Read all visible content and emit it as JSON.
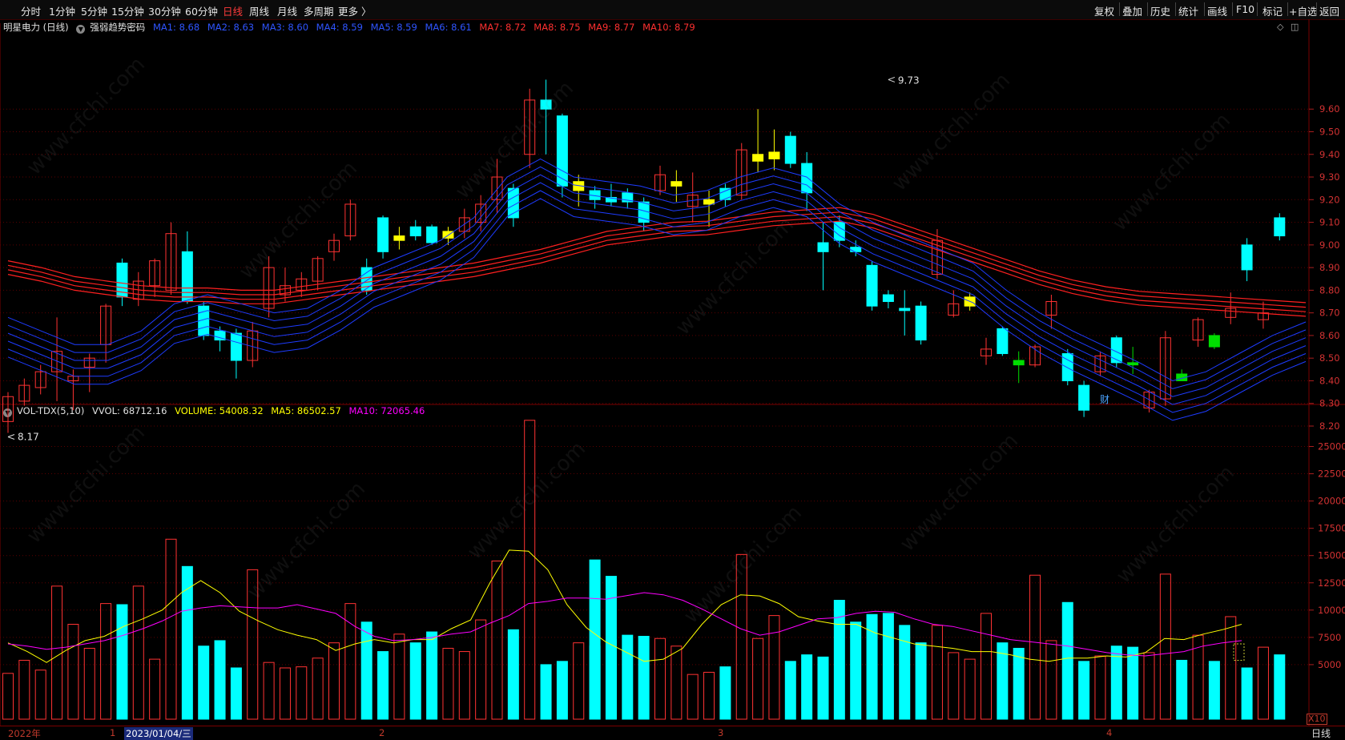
{
  "toolbar": {
    "left_tabs": [
      "分时",
      "1分钟",
      "5分钟",
      "15分钟",
      "30分钟",
      "60分钟",
      "日线",
      "周线",
      "月线",
      "多周期",
      "更多 〉"
    ],
    "active_tab": "日线",
    "right_tabs": [
      "复权",
      "叠加",
      "历史",
      "统计",
      "画线",
      "F10",
      "标记",
      "+自选",
      "返回"
    ]
  },
  "main_legend": {
    "stock": "明星电力 (日线)",
    "indicator": "强弱趋势密码",
    "ma_blue": [
      "MA1: 8.68",
      "MA2: 8.63",
      "MA3: 8.60",
      "MA4: 8.59",
      "MA5: 8.59",
      "MA6: 8.61"
    ],
    "ma_red": [
      "MA7: 8.72",
      "MA8: 8.75",
      "MA9: 8.77",
      "MA10: 8.79"
    ]
  },
  "vol_legend": {
    "name": "VOL-TDX(5,10)",
    "vvol": "VVOL: 68712.16",
    "volume": "VOLUME: 54008.32",
    "ma5": "MA5: 86502.57",
    "ma10": "MA10: 72065.46"
  },
  "annotations": {
    "high": "9.73",
    "low": "8.17",
    "cai": "财",
    "x10": "X10",
    "period": "日线"
  },
  "x_axis_labels": [
    "2022年",
    "1",
    "2023/01/04/三",
    "2",
    "3",
    "4"
  ],
  "watermark": "www.cfchi.com",
  "colors": {
    "up": "#ff3232",
    "down_big": "#00ffff",
    "yellow": "#ffff00",
    "green": "#00dd00",
    "ma_blue": "#1e3cff",
    "ma_red": "#ff2020",
    "vol_ma5": "#ffff00",
    "vol_ma10": "#ff00ff"
  },
  "chart_data": [
    {
      "type": "candlestick",
      "title": "明星电力 (日线)",
      "y_ticks": [
        9.6,
        9.5,
        9.4,
        9.3,
        9.2,
        9.1,
        9.0,
        8.9,
        8.8,
        8.7,
        8.6,
        8.5,
        8.4,
        8.3,
        8.2
      ],
      "ylim": [
        8.16,
        9.75
      ],
      "candles": [
        {
          "o": 8.22,
          "c": 8.33,
          "h": 8.35,
          "l": 8.17,
          "k": "up"
        },
        {
          "o": 8.31,
          "c": 8.38,
          "h": 8.41,
          "l": 8.29,
          "k": "up"
        },
        {
          "o": 8.37,
          "c": 8.44,
          "h": 8.47,
          "l": 8.34,
          "k": "up"
        },
        {
          "o": 8.44,
          "c": 8.53,
          "h": 8.68,
          "l": 8.31,
          "k": "up"
        },
        {
          "o": 8.4,
          "c": 8.42,
          "h": 8.45,
          "l": 8.27,
          "k": "up"
        },
        {
          "o": 8.46,
          "c": 8.5,
          "h": 8.52,
          "l": 8.35,
          "k": "up"
        },
        {
          "o": 8.56,
          "c": 8.73,
          "h": 8.74,
          "l": 8.48,
          "k": "up"
        },
        {
          "o": 8.76,
          "c": 8.84,
          "h": 8.88,
          "l": 8.73,
          "k": "up"
        },
        {
          "o": 8.82,
          "c": 8.93,
          "h": 8.94,
          "l": 8.77,
          "k": "up"
        },
        {
          "o": 8.8,
          "c": 9.05,
          "h": 9.1,
          "l": 8.78,
          "k": "up"
        },
        {
          "o": 8.62,
          "c": 8.49,
          "h": 8.66,
          "l": 8.46,
          "k": "up"
        },
        {
          "o": 8.72,
          "c": 8.9,
          "h": 8.95,
          "l": 8.68,
          "k": "up"
        },
        {
          "o": 8.78,
          "c": 8.82,
          "h": 8.9,
          "l": 8.75,
          "k": "up"
        },
        {
          "o": 8.8,
          "c": 8.85,
          "h": 8.88,
          "l": 8.77,
          "k": "up"
        },
        {
          "o": 8.84,
          "c": 8.94,
          "h": 8.95,
          "l": 8.8,
          "k": "up"
        },
        {
          "o": 8.97,
          "c": 9.02,
          "h": 9.05,
          "l": 8.93,
          "k": "up"
        },
        {
          "o": 9.04,
          "c": 9.18,
          "h": 9.2,
          "l": 9.02,
          "k": "up"
        },
        {
          "o": 9.02,
          "c": 9.04,
          "h": 9.08,
          "l": 8.98,
          "k": "up"
        },
        {
          "o": 9.03,
          "c": 9.06,
          "h": 9.08,
          "l": 9.0,
          "k": "up"
        },
        {
          "o": 9.06,
          "c": 9.12,
          "h": 9.16,
          "l": 9.03,
          "k": "up"
        },
        {
          "o": 9.1,
          "c": 9.18,
          "h": 9.22,
          "l": 9.06,
          "k": "up"
        },
        {
          "o": 9.2,
          "c": 9.3,
          "h": 9.38,
          "l": 9.14,
          "k": "up"
        },
        {
          "o": 9.4,
          "c": 9.64,
          "h": 9.69,
          "l": 9.34,
          "k": "up"
        },
        {
          "o": 9.24,
          "c": 9.28,
          "h": 9.31,
          "l": 9.17,
          "k": "up"
        },
        {
          "o": 9.24,
          "c": 9.31,
          "h": 9.35,
          "l": 9.22,
          "k": "up"
        },
        {
          "o": 9.26,
          "c": 9.28,
          "h": 9.33,
          "l": 9.19,
          "k": "up"
        },
        {
          "o": 9.17,
          "c": 9.22,
          "h": 9.32,
          "l": 9.1,
          "k": "up"
        },
        {
          "o": 9.18,
          "c": 9.2,
          "h": 9.24,
          "l": 9.08,
          "k": "up"
        },
        {
          "o": 9.22,
          "c": 9.42,
          "h": 9.45,
          "l": 9.2,
          "k": "up"
        },
        {
          "o": 9.37,
          "c": 9.4,
          "h": 9.6,
          "l": 9.32,
          "k": "up"
        },
        {
          "o": 9.38,
          "c": 9.41,
          "h": 9.51,
          "l": 9.33,
          "k": "up"
        },
        {
          "o": 9.02,
          "c": 8.87,
          "h": 9.07,
          "l": 8.85,
          "k": "up"
        },
        {
          "o": 8.74,
          "c": 8.69,
          "h": 8.8,
          "l": 8.68,
          "k": "up"
        },
        {
          "o": 8.73,
          "c": 8.77,
          "h": 8.79,
          "l": 8.71,
          "k": "up"
        },
        {
          "o": 8.51,
          "c": 8.54,
          "h": 8.59,
          "l": 8.47,
          "k": "up"
        },
        {
          "o": 8.47,
          "c": 8.55,
          "h": 8.56,
          "l": 8.46,
          "k": "up"
        },
        {
          "o": 8.69,
          "c": 8.75,
          "h": 8.78,
          "l": 8.63,
          "k": "up"
        },
        {
          "o": 8.44,
          "c": 8.51,
          "h": 8.53,
          "l": 8.42,
          "k": "up"
        },
        {
          "o": 8.28,
          "c": 8.35,
          "h": 8.36,
          "l": 8.26,
          "k": "up"
        },
        {
          "o": 8.32,
          "c": 8.59,
          "h": 8.62,
          "l": 8.29,
          "k": "up"
        },
        {
          "o": 8.58,
          "c": 8.67,
          "h": 8.68,
          "l": 8.55,
          "k": "up"
        },
        {
          "o": 8.68,
          "c": 8.72,
          "h": 8.79,
          "l": 8.65,
          "k": "up"
        },
        {
          "o": 8.67,
          "c": 8.7,
          "h": 8.75,
          "l": 8.63,
          "k": "up"
        },
        {
          "o": 8.92,
          "c": 8.77,
          "h": 8.94,
          "l": 8.73,
          "k": "down"
        },
        {
          "o": 8.97,
          "c": 8.75,
          "h": 9.06,
          "l": 8.74,
          "k": "down"
        },
        {
          "o": 8.73,
          "c": 8.6,
          "h": 8.75,
          "l": 8.58,
          "k": "down"
        },
        {
          "o": 8.62,
          "c": 8.58,
          "h": 8.64,
          "l": 8.53,
          "k": "down"
        },
        {
          "o": 8.61,
          "c": 8.49,
          "h": 8.63,
          "l": 8.41,
          "k": "down"
        },
        {
          "o": 8.9,
          "c": 8.8,
          "h": 8.94,
          "l": 8.78,
          "k": "down"
        },
        {
          "o": 9.12,
          "c": 8.97,
          "h": 9.13,
          "l": 8.94,
          "k": "down"
        },
        {
          "o": 9.08,
          "c": 9.04,
          "h": 9.11,
          "l": 9.02,
          "k": "down"
        },
        {
          "o": 9.08,
          "c": 9.01,
          "h": 9.09,
          "l": 9.0,
          "k": "down"
        },
        {
          "o": 9.25,
          "c": 9.12,
          "h": 9.27,
          "l": 9.08,
          "k": "down"
        },
        {
          "o": 9.64,
          "c": 9.6,
          "h": 9.73,
          "l": 9.4,
          "k": "down"
        },
        {
          "o": 9.57,
          "c": 9.26,
          "h": 9.58,
          "l": 9.21,
          "k": "down"
        },
        {
          "o": 9.24,
          "c": 9.2,
          "h": 9.26,
          "l": 9.16,
          "k": "down"
        },
        {
          "o": 9.21,
          "c": 9.19,
          "h": 9.27,
          "l": 9.17,
          "k": "down"
        },
        {
          "o": 9.23,
          "c": 9.19,
          "h": 9.25,
          "l": 9.16,
          "k": "down"
        },
        {
          "o": 9.19,
          "c": 9.1,
          "h": 9.21,
          "l": 9.06,
          "k": "down"
        },
        {
          "o": 9.25,
          "c": 9.2,
          "h": 9.27,
          "l": 9.17,
          "k": "down"
        },
        {
          "o": 9.48,
          "c": 9.36,
          "h": 9.5,
          "l": 9.34,
          "k": "down"
        },
        {
          "o": 9.36,
          "c": 9.23,
          "h": 9.41,
          "l": 9.15,
          "k": "down"
        },
        {
          "o": 9.01,
          "c": 8.97,
          "h": 9.1,
          "l": 8.8,
          "k": "down"
        },
        {
          "o": 9.1,
          "c": 9.02,
          "h": 9.13,
          "l": 8.99,
          "k": "down"
        },
        {
          "o": 8.99,
          "c": 8.97,
          "h": 9.02,
          "l": 8.95,
          "k": "down"
        },
        {
          "o": 8.91,
          "c": 8.73,
          "h": 8.93,
          "l": 8.71,
          "k": "down"
        },
        {
          "o": 8.78,
          "c": 8.75,
          "h": 8.8,
          "l": 8.72,
          "k": "down"
        },
        {
          "o": 8.72,
          "c": 8.71,
          "h": 8.8,
          "l": 8.6,
          "k": "down"
        },
        {
          "o": 8.73,
          "c": 8.58,
          "h": 8.75,
          "l": 8.56,
          "k": "down"
        },
        {
          "o": 8.63,
          "c": 8.52,
          "h": 8.64,
          "l": 8.51,
          "k": "down"
        },
        {
          "o": 8.49,
          "c": 8.47,
          "h": 8.53,
          "l": 8.39,
          "k": "down"
        },
        {
          "o": 8.52,
          "c": 8.4,
          "h": 8.54,
          "l": 8.38,
          "k": "down"
        },
        {
          "o": 8.38,
          "c": 8.27,
          "h": 8.4,
          "l": 8.24,
          "k": "down"
        },
        {
          "o": 8.59,
          "c": 8.48,
          "h": 8.6,
          "l": 8.46,
          "k": "down"
        },
        {
          "o": 8.48,
          "c": 8.47,
          "h": 8.55,
          "l": 8.43,
          "k": "down"
        },
        {
          "o": 8.43,
          "c": 8.4,
          "h": 8.45,
          "l": 8.4,
          "k": "down"
        },
        {
          "o": 8.6,
          "c": 8.55,
          "h": 8.61,
          "l": 8.54,
          "k": "down"
        },
        {
          "o": 9.0,
          "c": 8.89,
          "h": 9.03,
          "l": 8.84,
          "k": "down"
        },
        {
          "o": 9.12,
          "c": 9.04,
          "h": 9.14,
          "l": 9.02,
          "k": "down"
        }
      ]
    },
    {
      "type": "bar",
      "title": "VOL-TDX(5,10)",
      "y_ticks": [
        25000,
        22500,
        20000,
        17500,
        15000,
        12500,
        10000,
        7500,
        5000
      ],
      "ylim": [
        0,
        28200
      ],
      "volumes_up": [
        4200,
        5400,
        4500,
        12200,
        8700,
        6500,
        10600,
        12200,
        5500,
        16500,
        13700,
        5200,
        4700,
        4800,
        5600,
        7000,
        10600,
        7800,
        6500,
        6200,
        9100,
        14500,
        27400,
        7000,
        7400,
        6700,
        4100,
        4300,
        15100,
        7400,
        9500,
        8600,
        6100,
        5500,
        9700,
        13200,
        7200,
        5800,
        6100,
        13300,
        7700,
        9400,
        6600
      ],
      "volumes_down": [
        10500,
        14000,
        6700,
        7200,
        4700,
        8900,
        6200,
        7000,
        8000,
        8200,
        5000,
        5300,
        14600,
        13100,
        7700,
        7600,
        4800,
        5300,
        5900,
        5700,
        10900,
        8900,
        9600,
        9700,
        8600,
        7000,
        7000,
        6500,
        10700,
        5300,
        6700,
        6600,
        5400,
        5300,
        4700,
        5900,
        6700,
        7300
      ],
      "vol_ma5": [
        7000,
        6200,
        5200,
        6300,
        7200,
        7600,
        8500,
        9200,
        10000,
        11600,
        12700,
        11600,
        9900,
        9000,
        8200,
        7700,
        7300,
        6300,
        6900,
        7300,
        7000,
        7300,
        7300,
        8300,
        9100,
        12500,
        15500,
        15400,
        13700,
        10500,
        8400,
        7100,
        6200,
        5300,
        5500,
        6500,
        8700,
        10500,
        11400,
        11300,
        10600,
        9400,
        9000,
        8700,
        8700,
        7900,
        7400,
        6900,
        6700,
        6500,
        6200,
        6200,
        5900,
        5500,
        5300,
        5600,
        5600,
        5800,
        5700,
        6100,
        7400,
        7300,
        7800,
        8200,
        8700
      ],
      "vol_ma10": [
        6900,
        6700,
        6400,
        6600,
        6900,
        7200,
        7700,
        8300,
        9000,
        9900,
        10200,
        10400,
        10300,
        10200,
        10200,
        10500,
        10100,
        9700,
        8500,
        7600,
        7200,
        7300,
        7500,
        7800,
        8000,
        8800,
        9500,
        10600,
        10800,
        11100,
        11100,
        11000,
        11300,
        11600,
        11400,
        10900,
        10100,
        9200,
        8300,
        7700,
        8000,
        8600,
        9200,
        9300,
        9700,
        9900,
        9800,
        9200,
        8700,
        8500,
        8100,
        7700,
        7300,
        7100,
        6900,
        6700,
        6400,
        6100,
        5900,
        5800,
        6000,
        6200,
        6700,
        7000,
        7200
      ]
    }
  ]
}
